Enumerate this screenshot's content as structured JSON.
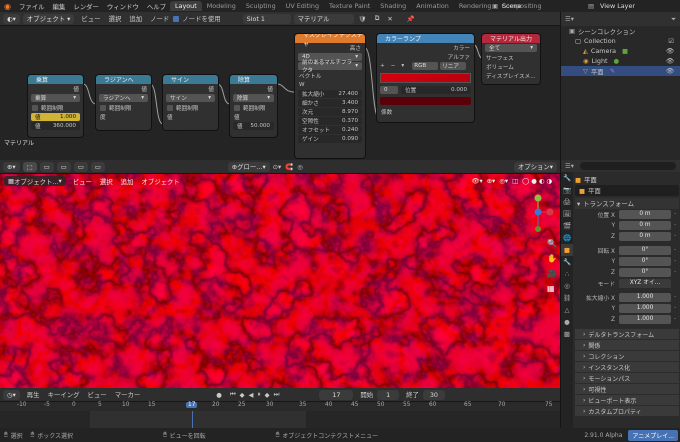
{
  "topbar": {
    "menus": [
      "ファイル",
      "編集",
      "レンダー",
      "ウィンドウ",
      "ヘルプ"
    ],
    "workspaces": [
      "Layout",
      "Modeling",
      "Sculpting",
      "UV Editing",
      "Texture Paint",
      "Shading",
      "Animation",
      "Rendering",
      "Compositing"
    ],
    "active_workspace": "Layout",
    "scene": "Scene",
    "view_layer": "View Layer"
  },
  "node_editor_header": {
    "mode": "オブジェクト",
    "menus": [
      "ビュー",
      "選択",
      "追加",
      "ノード"
    ],
    "use_nodes_label": "ノードを使用",
    "slot": "Slot 1",
    "material": "マテリアル"
  },
  "nodes": {
    "material_label": "マテリアル",
    "multiply": {
      "title": "乗算",
      "out": "値",
      "op": "乗算",
      "clamp": "範囲制限",
      "field_a_label": "値",
      "field_a": "1.000",
      "field_b_label": "値",
      "field_b": "360.000"
    },
    "radians": {
      "title": "ラジアンへ",
      "out": "値",
      "op": "ラジアンへ",
      "clamp": "範囲制限",
      "input": "度"
    },
    "sine": {
      "title": "サイン",
      "out": "値",
      "op": "サイン",
      "clamp": "範囲制限",
      "input": "値"
    },
    "divide": {
      "title": "除算",
      "out": "値",
      "op": "除算",
      "clamp": "範囲制限",
      "input": "値",
      "field_label": "値",
      "field": "50.000"
    },
    "musgrave": {
      "title": "マスグレイブテクスチャ",
      "out": "高さ",
      "dim": "4D",
      "type": "前のあるマルチフラクタ",
      "vector": "ベクトル",
      "w": "W",
      "params": [
        {
          "label": "拡大縮小",
          "value": "27.400"
        },
        {
          "label": "細かさ",
          "value": "3.400"
        },
        {
          "label": "次元",
          "value": "8.970"
        },
        {
          "label": "空隙性",
          "value": "0.370"
        },
        {
          "label": "オフセット",
          "value": "0.240"
        },
        {
          "label": "ゲイン",
          "value": "0.090"
        }
      ]
    },
    "colorramp": {
      "title": "カラーランプ",
      "out_color": "カラー",
      "out_alpha": "アルファ",
      "mode": "RGB",
      "interp": "リニア",
      "index": "0",
      "pos_label": "位置",
      "pos": "0.000",
      "factor": "係数",
      "plus": "+",
      "minus": "−"
    },
    "output": {
      "title": "マテリアル出力",
      "target": "全て",
      "surface": "サーフェス",
      "volume": "ボリューム",
      "displacement": "ディスプレイスメ..."
    }
  },
  "outliner": {
    "title": "シーンコレクション",
    "items": [
      {
        "label": "Collection"
      },
      {
        "label": "Camera"
      },
      {
        "label": "Light"
      },
      {
        "label": "平面"
      }
    ]
  },
  "viewport_header": {
    "mode": "オブジェクト...",
    "menus": [
      "ビュー",
      "選択",
      "追加",
      "オブジェクト"
    ],
    "shading": "グロー...",
    "options": "オプション"
  },
  "properties": {
    "search_placeholder": "",
    "object_name": "平面",
    "header_name": "平面",
    "transform_title": "トランスフォーム",
    "location_label": "位置 X",
    "location": [
      "0 m",
      "0 m",
      "0 m"
    ],
    "rotation_label": "回転 X",
    "rotation": [
      "0°",
      "0°",
      "0°"
    ],
    "mode_label": "モード",
    "mode_value": "XYZ オイ...",
    "scale_label": "拡大縮小 X",
    "scale": [
      "1.000",
      "1.000",
      "1.000"
    ],
    "axis_y": "Y",
    "axis_z": "Z",
    "delta_title": "デルタトランスフォーム",
    "sections": [
      "関係",
      "コレクション",
      "インスタンス化",
      "モーションパス",
      "可視性",
      "ビューポート表示",
      "カスタムプロパティ"
    ]
  },
  "timeline": {
    "menus": [
      "再生",
      "キーイング",
      "ビュー",
      "マーカー"
    ],
    "current_frame": "17",
    "start_label": "開始",
    "start": "1",
    "end_label": "終了",
    "end": "30",
    "ticks": [
      "-10",
      "-5",
      "0",
      "5",
      "10",
      "15",
      "17",
      "20",
      "25",
      "30",
      "35",
      "40",
      "45",
      "50",
      "55",
      "60",
      "65",
      "70",
      "75"
    ]
  },
  "statusbar": {
    "select": "選択",
    "box_select": "ボックス選択",
    "rotate_view": "ビューを回転",
    "context_menu": "オブジェクトコンテクストメニュー",
    "version": "2.91.0 Alpha",
    "mode_badge": "アニメプレイ..."
  },
  "colors": {
    "accent": "#4772b3",
    "math_node": "#3b7a95",
    "texture_node": "#e07b2e",
    "converter_node": "#4485b9",
    "output_node": "#b5273a",
    "viewport_red": "#d40010"
  }
}
